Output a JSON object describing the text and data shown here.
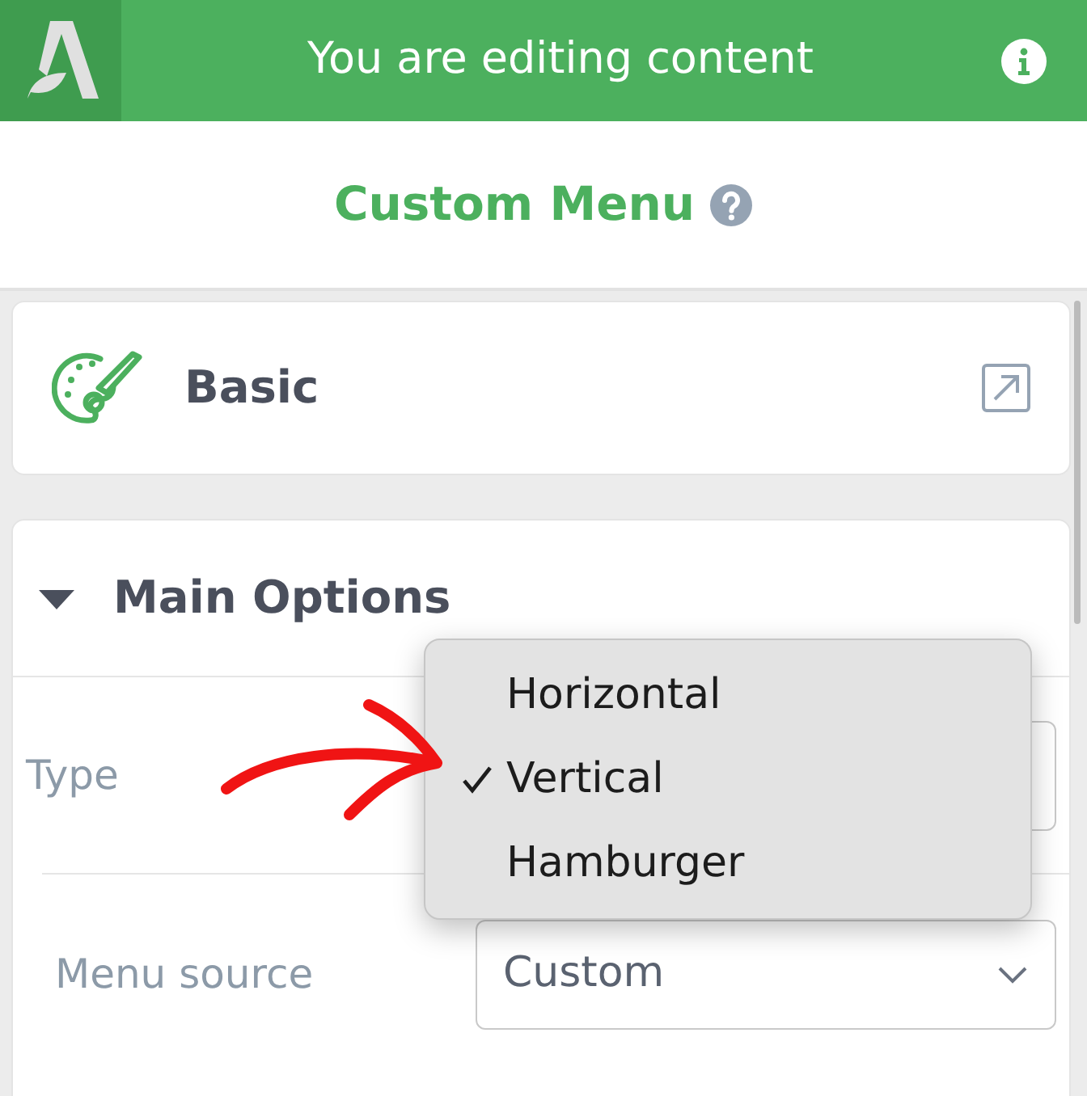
{
  "header": {
    "title": "You are editing content"
  },
  "panel": {
    "title": "Custom Menu"
  },
  "sections": [
    {
      "kind": "link",
      "title": "Basic"
    },
    {
      "kind": "group",
      "title": "Main Options",
      "expanded": true,
      "fields": [
        {
          "label": "Type",
          "kind": "select-open",
          "options": [
            {
              "label": "Horizontal",
              "selected": false
            },
            {
              "label": "Vertical",
              "selected": true
            },
            {
              "label": "Hamburger",
              "selected": false
            }
          ]
        },
        {
          "label": "Menu source",
          "kind": "select",
          "value": "Custom"
        }
      ]
    }
  ]
}
